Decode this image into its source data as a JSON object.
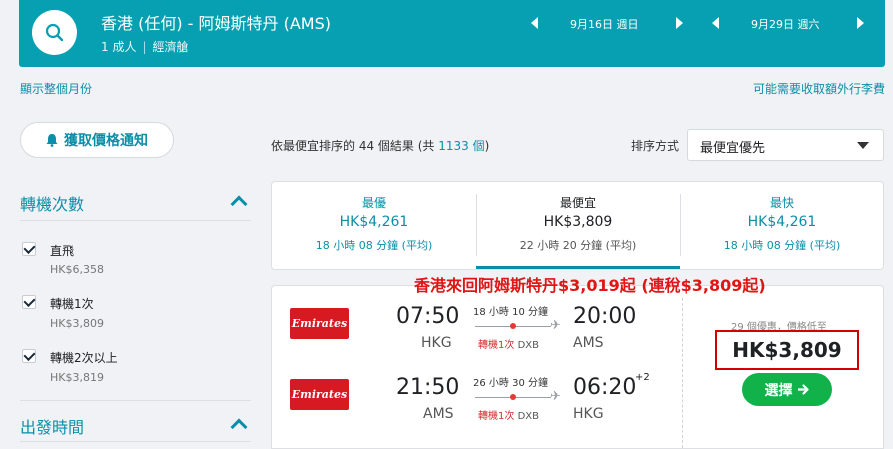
{
  "header": {
    "route": "香港 (任何) - 阿姆斯特丹 (AMS)",
    "passengers": "1 成人",
    "cabin": "經濟艙",
    "depart_date": "9月16日 週日",
    "return_date": "9月29日 週六"
  },
  "links": {
    "show_month": "顯示整個月份",
    "extra_fees": "可能需要收取額外行李費"
  },
  "sidebar": {
    "alert_button": "獲取價格通知",
    "stops_title": "轉機次數",
    "stops_options": [
      {
        "label": "直飛",
        "price": "HK$6,358"
      },
      {
        "label": "轉機1次",
        "price": "HK$3,809"
      },
      {
        "label": "轉機2次以上",
        "price": "HK$3,819"
      }
    ],
    "depart_time_title": "出發時間"
  },
  "results": {
    "summary_pre": "依最便宜排序的 44 個結果 (共 ",
    "summary_link": "1133 個",
    "summary_post": ")",
    "sort_label": "排序方式",
    "sort_value": "最便宜優先"
  },
  "tabs": [
    {
      "label": "最優",
      "price": "HK$4,261",
      "duration": "18 小時 08 分鐘 (平均)"
    },
    {
      "label": "最便宜",
      "price": "HK$3,809",
      "duration": "22 小時 20 分鐘 (平均)"
    },
    {
      "label": "最快",
      "price": "HK$4,261",
      "duration": "18 小時 08 分鐘 (平均)"
    }
  ],
  "overlay_text": "香港來回阿姆斯特丹$3,019起 (連稅$3,809起)",
  "card": {
    "airline": "Emirates",
    "outbound": {
      "dep_time": "07:50",
      "dep_code": "HKG",
      "arr_time": "20:00",
      "arr_code": "AMS",
      "duration": "18 小時 10 分鐘",
      "stops": "轉機1次",
      "via": "DXB"
    },
    "inbound": {
      "dep_time": "21:50",
      "dep_code": "AMS",
      "arr_time": "06:20",
      "arr_code": "HKG",
      "day_offset": "+2",
      "duration": "26 小時 30 分鐘",
      "stops": "轉機1次",
      "via": "DXB"
    },
    "deals": "29 個優惠，價格低至",
    "price": "HK$3,809",
    "select_button": "選擇"
  },
  "colors": {
    "accent": "#06a0b2",
    "link": "#0b8fa8",
    "select": "#12b24a",
    "highlight": "#e01616"
  }
}
